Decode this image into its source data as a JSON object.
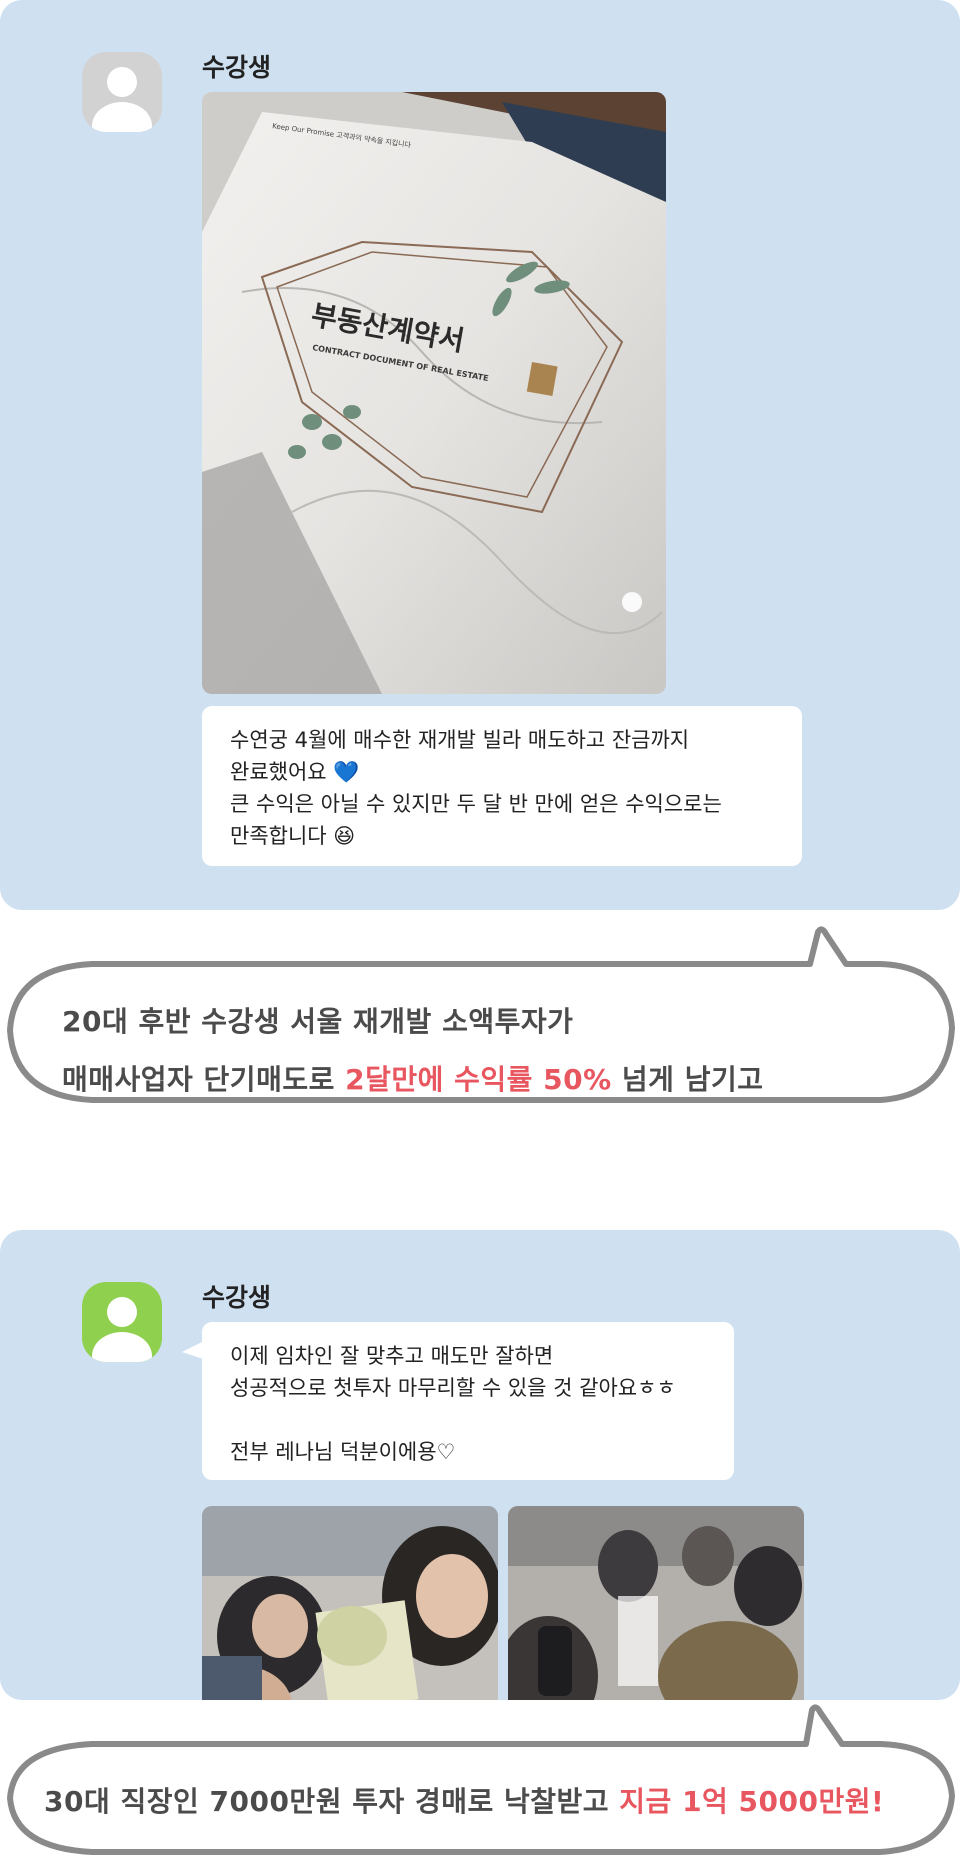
{
  "chat1": {
    "sender": "수강생",
    "photo_title": "부동산계약서",
    "photo_subtitle": "CONTRACT DOCUMENT OF REAL ESTATE",
    "photo_top_text": "Keep Our Promise 고객과의 약속을 지킵니다",
    "message_lines": [
      "수연궁 4월에 매수한 재개발 빌라 매도하고 잔금까지",
      "완료했어요 💙",
      "큰 수익은 아닐 수 있지만 두 달 반 만에 얻은 수익으로는",
      "만족합니다 😆"
    ]
  },
  "callout1": {
    "line1": "20대 후반 수강생 서울 재개발 소액투자가",
    "line2_plain": "매매사업자 단기매도로 ",
    "line2_highlight": "2달만에 수익률 50%",
    "line2_end": " 넘게 남기고"
  },
  "chat2": {
    "sender": "수강생",
    "message_lines": [
      "이제 임차인 잘 맞추고 매도만 잘하면",
      "성공적으로 첫투자 마무리할 수 있을 것 같아요ㅎㅎ",
      "",
      "전부 레나님 덕분이에용♡"
    ]
  },
  "callout2": {
    "plain": "30대 직장인 7000만원 투자 경매로 낙찰받고 ",
    "highlight": "지금 1억 5000만원!"
  },
  "colors": {
    "panel_bg": "#cfe0f1",
    "highlight": "#e85660",
    "avatar_gray": "#d2d2d2",
    "avatar_green": "#8fd14f"
  }
}
